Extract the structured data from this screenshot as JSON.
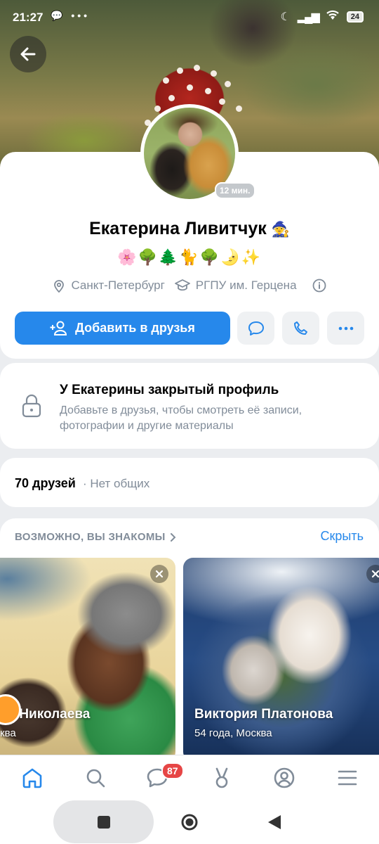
{
  "status_bar": {
    "time": "21:27",
    "left_icons": "💬 •••",
    "battery": "24"
  },
  "profile": {
    "name": "Екатерина Ливитчук",
    "name_emoji": "🧙",
    "emoji_status": "🌸🌳🌲🐈🌳🌛✨",
    "online": "12 мин.",
    "city": "Санкт-Петербург",
    "university": "РГПУ им. Герцена"
  },
  "actions": {
    "add_friend": "Добавить в друзья"
  },
  "closed_profile": {
    "title": "У Екатерины закрытый профиль",
    "description": "Добавьте в друзья, чтобы смотреть её записи, фотографии и другие материалы"
  },
  "friends": {
    "count": "70 друзей",
    "common": "· Нет общих"
  },
  "suggestions": {
    "title": "ВОЗМОЖНО, ВЫ ЗНАКОМЫ",
    "hide": "Скрыть",
    "items": [
      {
        "name": "на Николаева",
        "sub": "ква"
      },
      {
        "name": "Виктория Платонова",
        "sub": "54 года, Москва"
      }
    ]
  },
  "tabbar": {
    "messages_badge": "87"
  },
  "colors": {
    "accent": "#2688eb",
    "secondary_text": "#818c99",
    "badge": "#e64646"
  }
}
